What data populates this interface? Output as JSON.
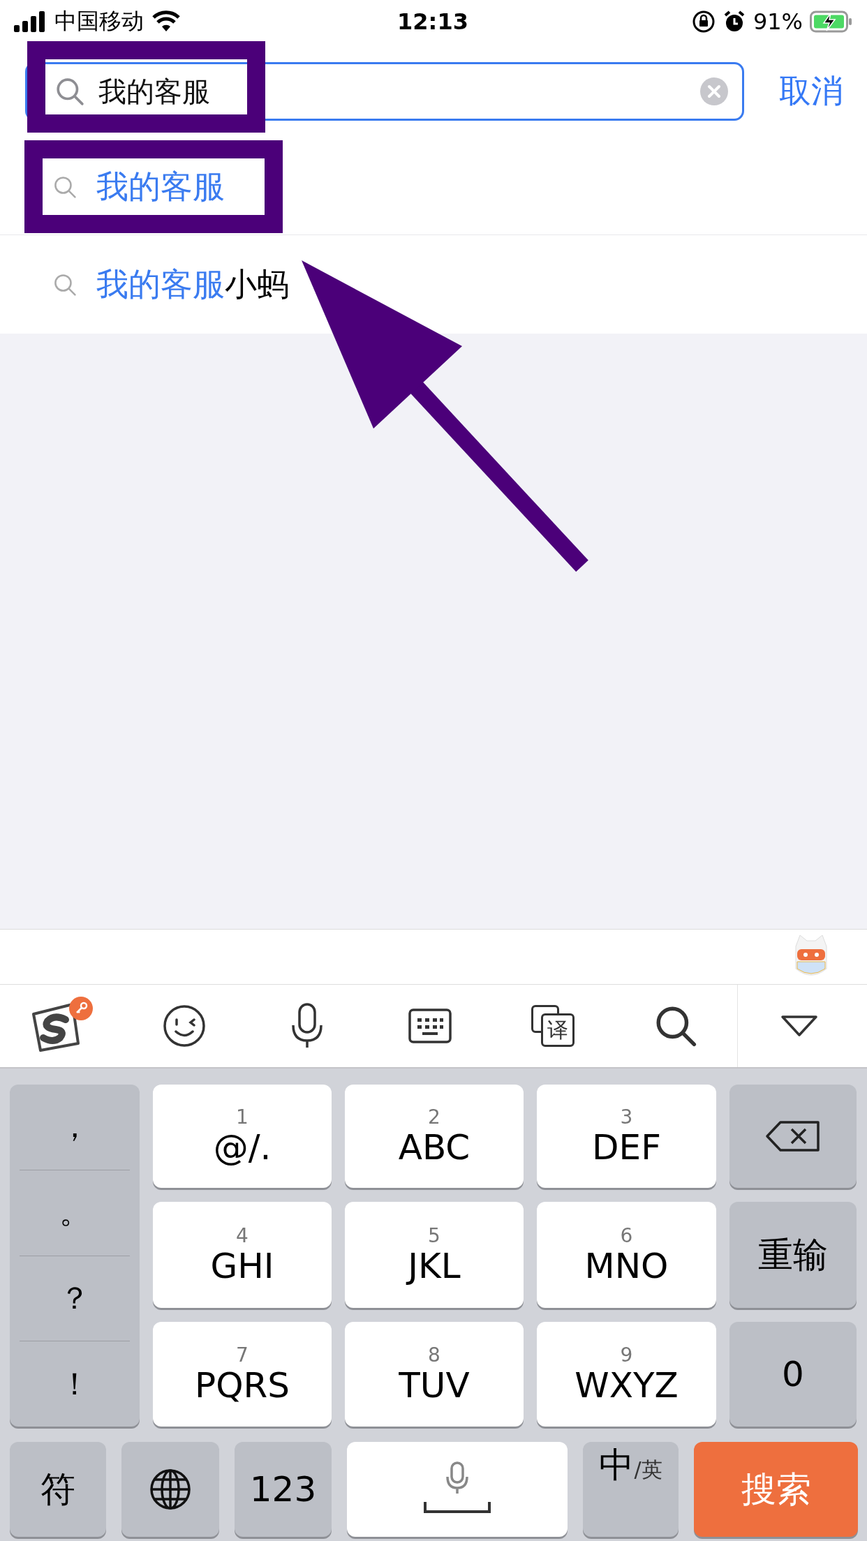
{
  "status_bar": {
    "carrier": "中国移动",
    "time": "12:13",
    "battery": "91%"
  },
  "search": {
    "value": "我的客服",
    "cancel": "取消"
  },
  "suggestions": [
    {
      "match": "我的客服"
    },
    {
      "match": "我的客服",
      "rest": "小蚂"
    }
  ],
  "keyboard": {
    "translate_label": "译",
    "symbols": [
      "，",
      "。",
      "？",
      "！"
    ],
    "keys": [
      {
        "digit": "1",
        "letters": "@/."
      },
      {
        "digit": "2",
        "letters": "ABC"
      },
      {
        "digit": "3",
        "letters": "DEF"
      },
      {
        "digit": "4",
        "letters": "GHI"
      },
      {
        "digit": "5",
        "letters": "JKL"
      },
      {
        "digit": "6",
        "letters": "MNO"
      },
      {
        "digit": "7",
        "letters": "PQRS"
      },
      {
        "digit": "8",
        "letters": "TUV"
      },
      {
        "digit": "9",
        "letters": "WXYZ"
      }
    ],
    "side_keys": [
      {
        "kind": "backspace"
      },
      {
        "kind": "text",
        "label": "重输"
      },
      {
        "kind": "text",
        "label": "0"
      }
    ],
    "bottom": [
      {
        "kind": "text",
        "label": "符"
      },
      {
        "kind": "globe"
      },
      {
        "kind": "text",
        "label": "123"
      },
      {
        "kind": "space"
      },
      {
        "kind": "lang",
        "label": "中",
        "sub": "/英"
      },
      {
        "kind": "action",
        "label": "搜索"
      }
    ]
  },
  "annotations": [
    {
      "kind": "box"
    },
    {
      "kind": "box"
    },
    {
      "kind": "arrow"
    }
  ]
}
